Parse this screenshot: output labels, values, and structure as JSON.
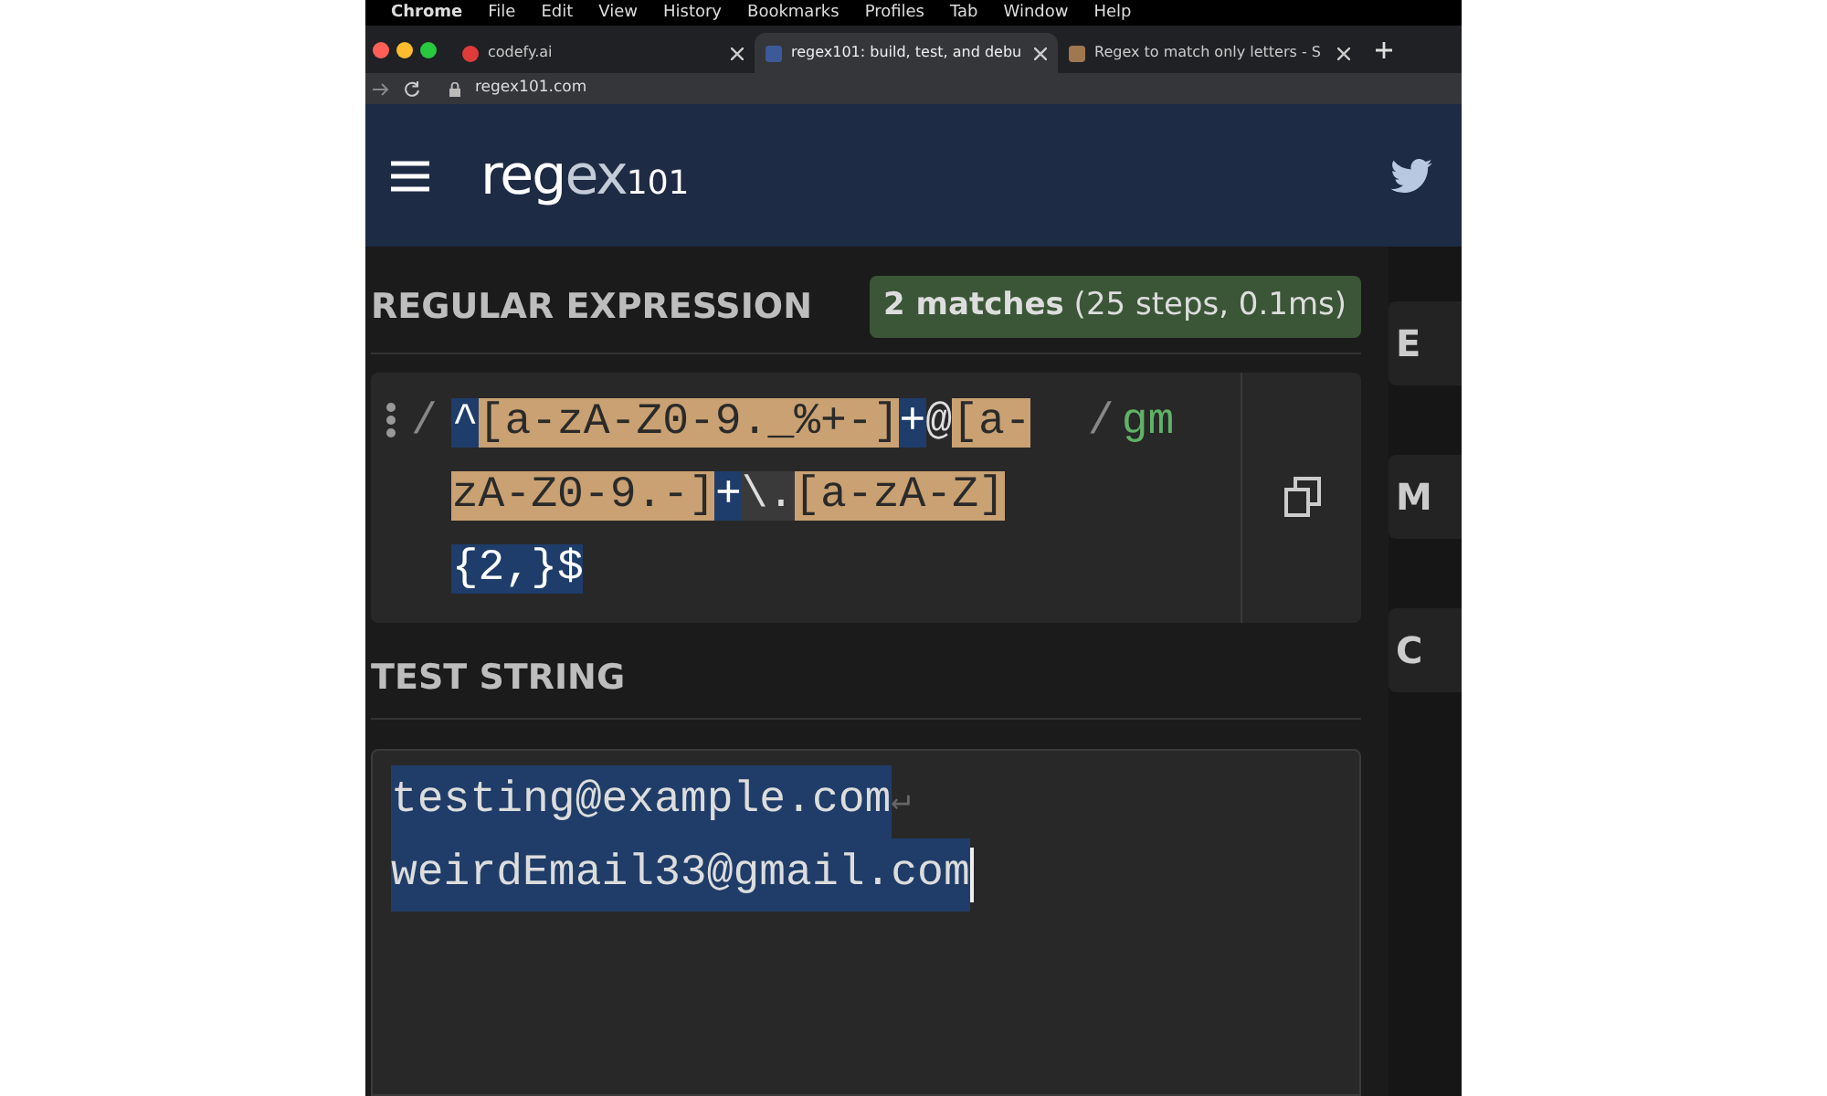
{
  "menu_bar": {
    "items": [
      "Chrome",
      "File",
      "Edit",
      "View",
      "History",
      "Bookmarks",
      "Profiles",
      "Tab",
      "Window",
      "Help"
    ]
  },
  "tabs": [
    {
      "title": "codefy.ai",
      "selected": false
    },
    {
      "title": "regex101: build, test, and debu",
      "selected": true
    },
    {
      "title": "Regex to match only letters - S",
      "selected": false
    }
  ],
  "address_bar": {
    "url": "regex101.com"
  },
  "header": {
    "logo": {
      "main": "reg",
      "accent": "ex",
      "suffix": "101"
    }
  },
  "regex_section": {
    "title": "REGULAR EXPRESSION",
    "match_summary": "**2 matches** (25 steps, 0.1ms)",
    "delimiter_open": "/",
    "delimiter_close": "/",
    "flags": "gm",
    "tokens": [
      {
        "kind": "anchor",
        "text": "^"
      },
      {
        "kind": "class",
        "text": "[a-zA-Z0-9._%+-]"
      },
      {
        "kind": "quantifier",
        "text": "+"
      },
      {
        "kind": "literal",
        "text": "@"
      },
      {
        "kind": "class",
        "text": "[a-zA-Z0-9.-]"
      },
      {
        "kind": "quantifier",
        "text": "+"
      },
      {
        "kind": "escape",
        "text": "\\."
      },
      {
        "kind": "class",
        "text": "[a-zA-Z]"
      },
      {
        "kind": "quantifier",
        "text": "{2,}"
      },
      {
        "kind": "anchor",
        "text": "$"
      }
    ]
  },
  "test_section": {
    "title": "TEST STRING",
    "lines": [
      {
        "text": "testing@example.com",
        "matched": true,
        "line_end": "↵",
        "cursor": false
      },
      {
        "text": "weirdEmail33@gmail.com",
        "matched": true,
        "cursor": true
      }
    ]
  },
  "side_panel": {
    "cut_labels": [
      "E",
      "M",
      "C"
    ]
  }
}
